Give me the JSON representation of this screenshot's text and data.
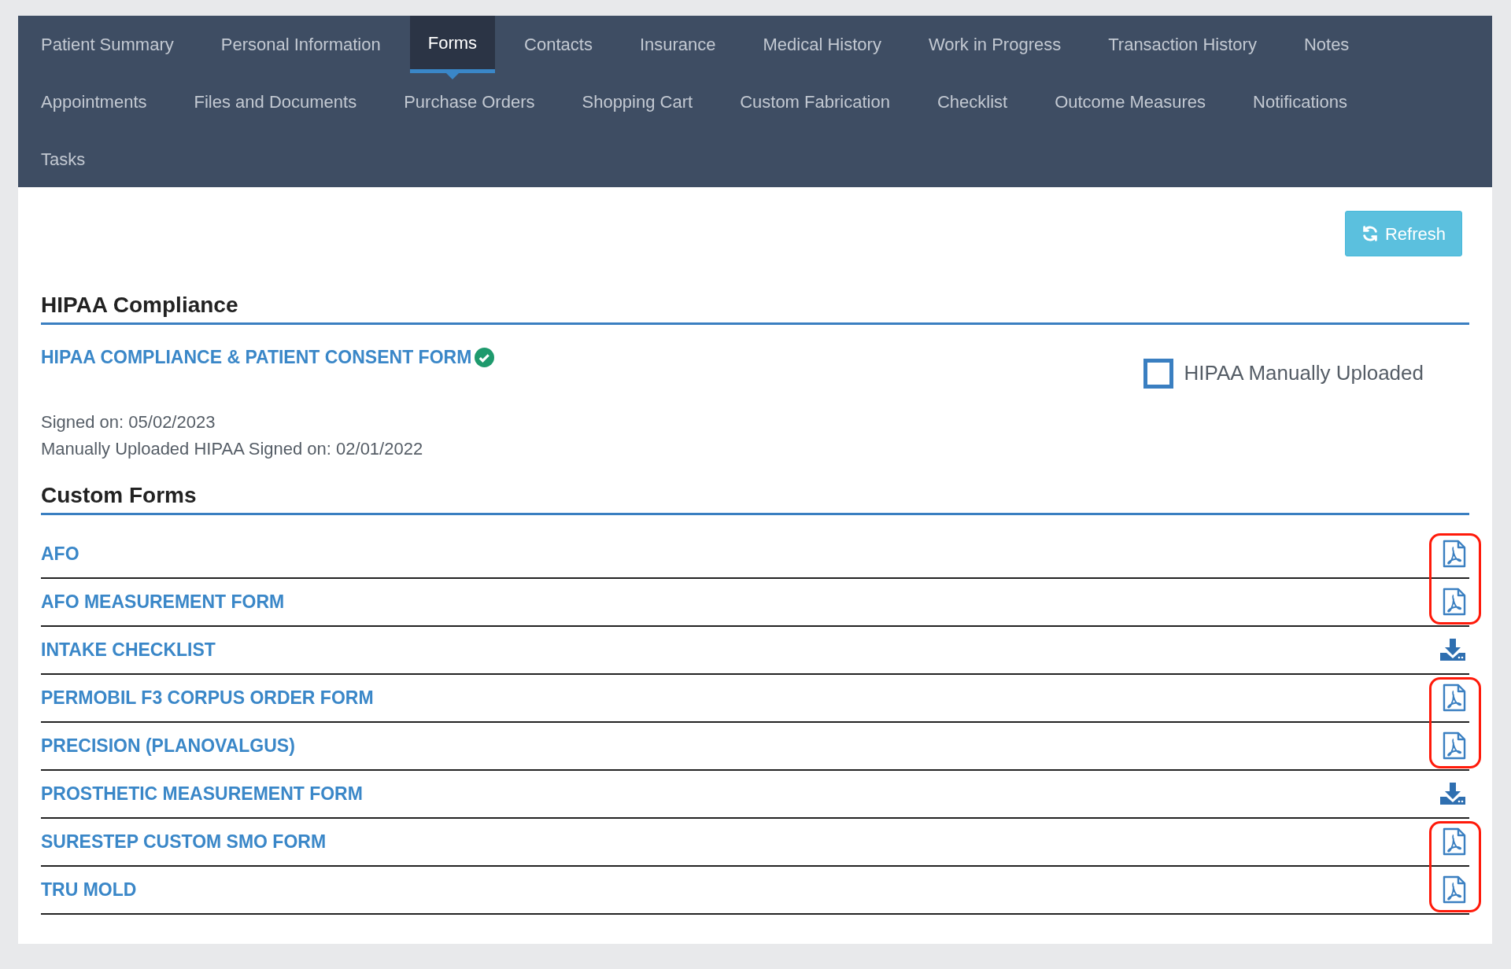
{
  "tabs": [
    {
      "label": "Patient Summary",
      "selected": false
    },
    {
      "label": "Personal Information",
      "selected": false
    },
    {
      "label": "Forms",
      "selected": true
    },
    {
      "label": "Contacts",
      "selected": false
    },
    {
      "label": "Insurance",
      "selected": false
    },
    {
      "label": "Medical History",
      "selected": false
    },
    {
      "label": "Work in Progress",
      "selected": false
    },
    {
      "label": "Transaction History",
      "selected": false
    },
    {
      "label": "Notes",
      "selected": false
    },
    {
      "label": "Appointments",
      "selected": false
    },
    {
      "label": "Files and Documents",
      "selected": false
    },
    {
      "label": "Purchase Orders",
      "selected": false
    },
    {
      "label": "Shopping Cart",
      "selected": false
    },
    {
      "label": "Custom Fabrication",
      "selected": false
    },
    {
      "label": "Checklist",
      "selected": false
    },
    {
      "label": "Outcome Measures",
      "selected": false
    },
    {
      "label": "Notifications",
      "selected": false
    },
    {
      "label": "Tasks",
      "selected": false
    }
  ],
  "refresh_button": "Refresh",
  "hipaa": {
    "heading": "HIPAA Compliance",
    "form_link": "HIPAA COMPLIANCE & PATIENT CONSENT FORM",
    "completed": true,
    "manual_checkbox": {
      "label": "HIPAA Manually Uploaded",
      "checked": false
    },
    "signed_lines": [
      "Signed on: 05/02/2023",
      "Manually Uploaded HIPAA Signed on: 02/01/2022"
    ]
  },
  "custom_forms": {
    "heading": "Custom Forms",
    "rows": [
      {
        "name": "AFO",
        "kind": "pdf",
        "highlighted": true
      },
      {
        "name": "AFO MEASUREMENT FORM",
        "kind": "pdf",
        "highlighted": true
      },
      {
        "name": "INTAKE CHECKLIST",
        "kind": "download",
        "highlighted": false
      },
      {
        "name": "PERMOBIL F3 CORPUS ORDER FORM",
        "kind": "pdf",
        "highlighted": true
      },
      {
        "name": "PRECISION (PLANOVALGUS)",
        "kind": "pdf",
        "highlighted": true
      },
      {
        "name": "PROSTHETIC MEASUREMENT FORM",
        "kind": "download",
        "highlighted": false
      },
      {
        "name": "SURESTEP CUSTOM SMO FORM",
        "kind": "pdf",
        "highlighted": true
      },
      {
        "name": "TRU MOLD",
        "kind": "pdf",
        "highlighted": true
      }
    ]
  }
}
